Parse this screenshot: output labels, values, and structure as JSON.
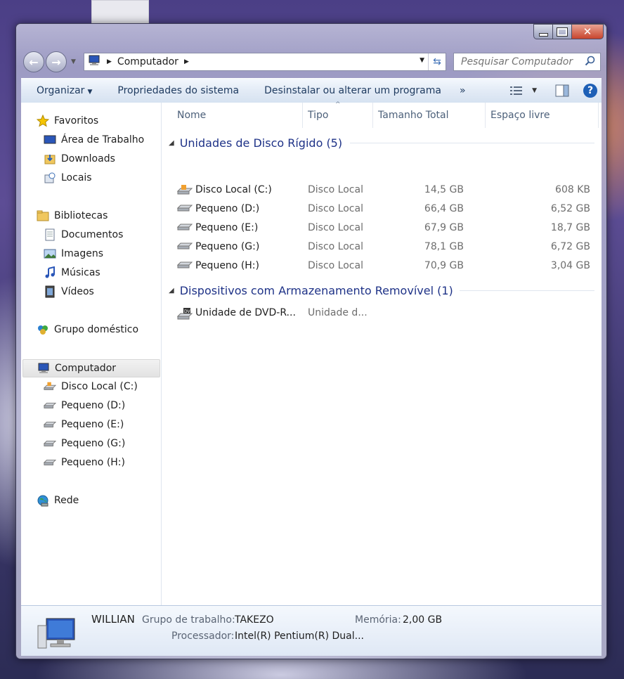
{
  "window": {
    "caption": {
      "minimize": "",
      "maximize": "",
      "close": "✕"
    }
  },
  "address_bar": {
    "crumb": "Computador",
    "search_placeholder": "Pesquisar Computador"
  },
  "toolbar": {
    "organize": "Organizar",
    "system_properties": "Propriedades do sistema",
    "uninstall": "Desinstalar ou alterar um programa",
    "more": "»"
  },
  "nav_pane": {
    "favorites": {
      "label": "Favoritos",
      "items": [
        "Área de Trabalho",
        "Downloads",
        "Locais"
      ]
    },
    "libraries": {
      "label": "Bibliotecas",
      "items": [
        "Documentos",
        "Imagens",
        "Músicas",
        "Vídeos"
      ]
    },
    "homegroup": "Grupo doméstico",
    "computer": {
      "label": "Computador",
      "items": [
        "Disco Local (C:)",
        "Pequeno (D:)",
        "Pequeno (E:)",
        "Pequeno (G:)",
        "Pequeno (H:)"
      ]
    },
    "network": "Rede"
  },
  "columns": [
    "Nome",
    "Tipo",
    "Tamanho Total",
    "Espaço livre"
  ],
  "groups": [
    {
      "title": "Unidades de Disco Rígido (5)",
      "rows": [
        {
          "name": "Disco Local (C:)",
          "type": "Disco Local",
          "size": "14,5 GB",
          "free": "608 KB"
        },
        {
          "name": "Pequeno (D:)",
          "type": "Disco Local",
          "size": "66,4 GB",
          "free": "6,52 GB"
        },
        {
          "name": "Pequeno (E:)",
          "type": "Disco Local",
          "size": "67,9 GB",
          "free": "18,7 GB"
        },
        {
          "name": "Pequeno (G:)",
          "type": "Disco Local",
          "size": "78,1 GB",
          "free": "6,72 GB"
        },
        {
          "name": "Pequeno (H:)",
          "type": "Disco Local",
          "size": "70,9 GB",
          "free": "3,04 GB"
        }
      ]
    },
    {
      "title": "Dispositivos com Armazenamento Removível (1)",
      "rows": [
        {
          "name": "Unidade de DVD-R...",
          "type": "Unidade d...",
          "size": "",
          "free": ""
        }
      ]
    }
  ],
  "details": {
    "computer_name": "WILLIAN",
    "workgroup_label": "Grupo de trabalho:",
    "workgroup_value": "TAKEZO",
    "memory_label": "Memória:",
    "memory_value": "2,00 GB",
    "processor_label": "Processador:",
    "processor_value": "Intel(R) Pentium(R) Dual..."
  },
  "colors": {
    "group_header": "#1e3287",
    "toolbar_text": "#1e3a5f",
    "close_button": "#c8452d"
  }
}
